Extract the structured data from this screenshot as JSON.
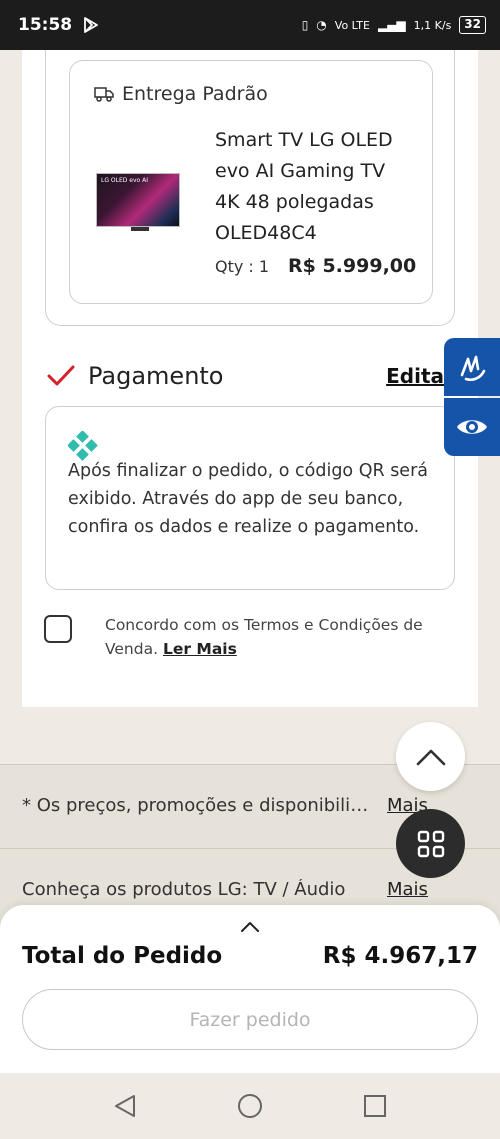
{
  "status_bar": {
    "time": "15:58",
    "network_label": "Vo LTE",
    "speed": "1,1 K/s",
    "battery": "32"
  },
  "shipping": {
    "method": "Entrega Padrão",
    "thumbnail_label": "LG OLED evo AI",
    "product_name": "Smart TV LG OLED evo AI Gaming TV 4K 48 polegadas OLED48C4",
    "qty_label": "Qty : 1",
    "price": "R$ 5.999,00"
  },
  "payment": {
    "title": "Pagamento",
    "edit_label": "Edita",
    "pix_message": "Após finalizar o pedido, o código QR será exibido. Através do app de seu banco, confira os dados e realize o pagamento."
  },
  "terms": {
    "text": "Concordo com os Termos e Condições de Venda.",
    "link_label": "Ler Mais"
  },
  "footer": {
    "rows": [
      {
        "text": "* Os preços, promoções e disponibilidade",
        "more": "Mais"
      },
      {
        "text": "Conheça os produtos LG: TV / Áudio",
        "more": "Mais"
      }
    ]
  },
  "order": {
    "total_label": "Total do Pedido",
    "total_value": "R$ 4.967,17",
    "place_order_label": "Fazer pedido"
  },
  "colors": {
    "accent_red": "#d6202a",
    "accessibility_blue": "#1554a8",
    "pix_teal": "#32bcad"
  }
}
